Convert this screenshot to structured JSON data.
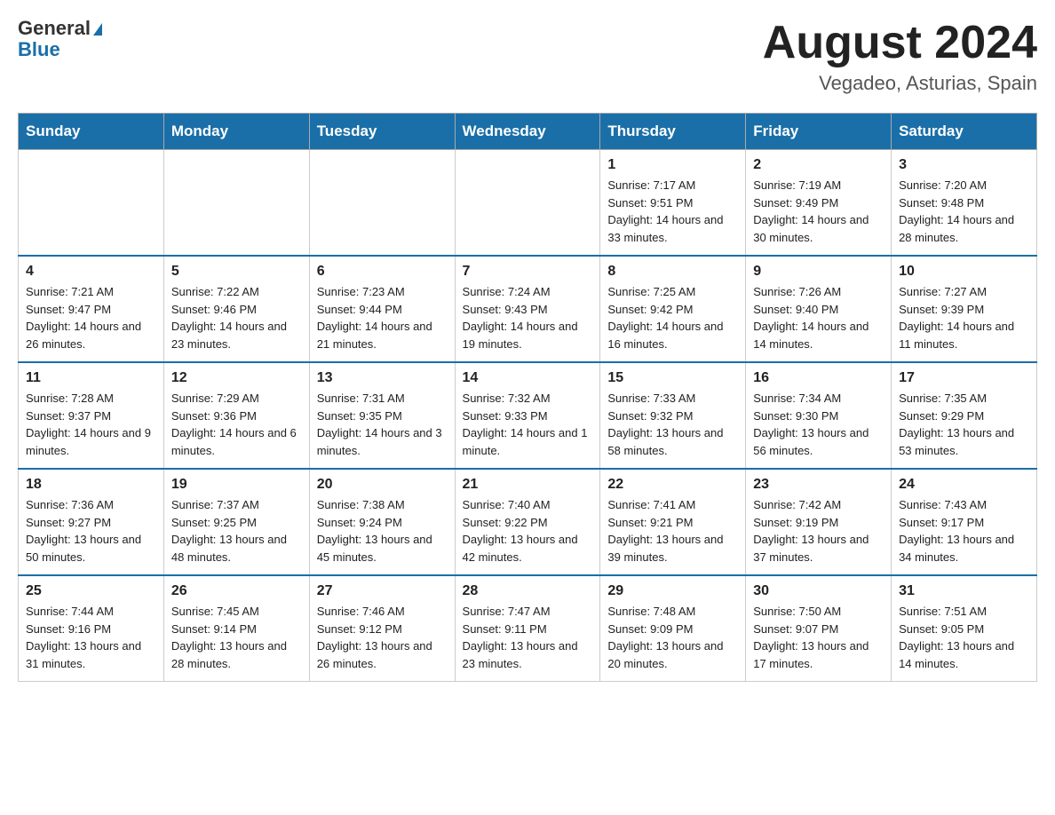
{
  "header": {
    "logo_general": "General",
    "logo_blue": "Blue",
    "month_title": "August 2024",
    "location": "Vegadeo, Asturias, Spain"
  },
  "days_of_week": [
    "Sunday",
    "Monday",
    "Tuesday",
    "Wednesday",
    "Thursday",
    "Friday",
    "Saturday"
  ],
  "weeks": [
    [
      {
        "day": "",
        "info": ""
      },
      {
        "day": "",
        "info": ""
      },
      {
        "day": "",
        "info": ""
      },
      {
        "day": "",
        "info": ""
      },
      {
        "day": "1",
        "info": "Sunrise: 7:17 AM\nSunset: 9:51 PM\nDaylight: 14 hours and 33 minutes."
      },
      {
        "day": "2",
        "info": "Sunrise: 7:19 AM\nSunset: 9:49 PM\nDaylight: 14 hours and 30 minutes."
      },
      {
        "day": "3",
        "info": "Sunrise: 7:20 AM\nSunset: 9:48 PM\nDaylight: 14 hours and 28 minutes."
      }
    ],
    [
      {
        "day": "4",
        "info": "Sunrise: 7:21 AM\nSunset: 9:47 PM\nDaylight: 14 hours and 26 minutes."
      },
      {
        "day": "5",
        "info": "Sunrise: 7:22 AM\nSunset: 9:46 PM\nDaylight: 14 hours and 23 minutes."
      },
      {
        "day": "6",
        "info": "Sunrise: 7:23 AM\nSunset: 9:44 PM\nDaylight: 14 hours and 21 minutes."
      },
      {
        "day": "7",
        "info": "Sunrise: 7:24 AM\nSunset: 9:43 PM\nDaylight: 14 hours and 19 minutes."
      },
      {
        "day": "8",
        "info": "Sunrise: 7:25 AM\nSunset: 9:42 PM\nDaylight: 14 hours and 16 minutes."
      },
      {
        "day": "9",
        "info": "Sunrise: 7:26 AM\nSunset: 9:40 PM\nDaylight: 14 hours and 14 minutes."
      },
      {
        "day": "10",
        "info": "Sunrise: 7:27 AM\nSunset: 9:39 PM\nDaylight: 14 hours and 11 minutes."
      }
    ],
    [
      {
        "day": "11",
        "info": "Sunrise: 7:28 AM\nSunset: 9:37 PM\nDaylight: 14 hours and 9 minutes."
      },
      {
        "day": "12",
        "info": "Sunrise: 7:29 AM\nSunset: 9:36 PM\nDaylight: 14 hours and 6 minutes."
      },
      {
        "day": "13",
        "info": "Sunrise: 7:31 AM\nSunset: 9:35 PM\nDaylight: 14 hours and 3 minutes."
      },
      {
        "day": "14",
        "info": "Sunrise: 7:32 AM\nSunset: 9:33 PM\nDaylight: 14 hours and 1 minute."
      },
      {
        "day": "15",
        "info": "Sunrise: 7:33 AM\nSunset: 9:32 PM\nDaylight: 13 hours and 58 minutes."
      },
      {
        "day": "16",
        "info": "Sunrise: 7:34 AM\nSunset: 9:30 PM\nDaylight: 13 hours and 56 minutes."
      },
      {
        "day": "17",
        "info": "Sunrise: 7:35 AM\nSunset: 9:29 PM\nDaylight: 13 hours and 53 minutes."
      }
    ],
    [
      {
        "day": "18",
        "info": "Sunrise: 7:36 AM\nSunset: 9:27 PM\nDaylight: 13 hours and 50 minutes."
      },
      {
        "day": "19",
        "info": "Sunrise: 7:37 AM\nSunset: 9:25 PM\nDaylight: 13 hours and 48 minutes."
      },
      {
        "day": "20",
        "info": "Sunrise: 7:38 AM\nSunset: 9:24 PM\nDaylight: 13 hours and 45 minutes."
      },
      {
        "day": "21",
        "info": "Sunrise: 7:40 AM\nSunset: 9:22 PM\nDaylight: 13 hours and 42 minutes."
      },
      {
        "day": "22",
        "info": "Sunrise: 7:41 AM\nSunset: 9:21 PM\nDaylight: 13 hours and 39 minutes."
      },
      {
        "day": "23",
        "info": "Sunrise: 7:42 AM\nSunset: 9:19 PM\nDaylight: 13 hours and 37 minutes."
      },
      {
        "day": "24",
        "info": "Sunrise: 7:43 AM\nSunset: 9:17 PM\nDaylight: 13 hours and 34 minutes."
      }
    ],
    [
      {
        "day": "25",
        "info": "Sunrise: 7:44 AM\nSunset: 9:16 PM\nDaylight: 13 hours and 31 minutes."
      },
      {
        "day": "26",
        "info": "Sunrise: 7:45 AM\nSunset: 9:14 PM\nDaylight: 13 hours and 28 minutes."
      },
      {
        "day": "27",
        "info": "Sunrise: 7:46 AM\nSunset: 9:12 PM\nDaylight: 13 hours and 26 minutes."
      },
      {
        "day": "28",
        "info": "Sunrise: 7:47 AM\nSunset: 9:11 PM\nDaylight: 13 hours and 23 minutes."
      },
      {
        "day": "29",
        "info": "Sunrise: 7:48 AM\nSunset: 9:09 PM\nDaylight: 13 hours and 20 minutes."
      },
      {
        "day": "30",
        "info": "Sunrise: 7:50 AM\nSunset: 9:07 PM\nDaylight: 13 hours and 17 minutes."
      },
      {
        "day": "31",
        "info": "Sunrise: 7:51 AM\nSunset: 9:05 PM\nDaylight: 13 hours and 14 minutes."
      }
    ]
  ]
}
